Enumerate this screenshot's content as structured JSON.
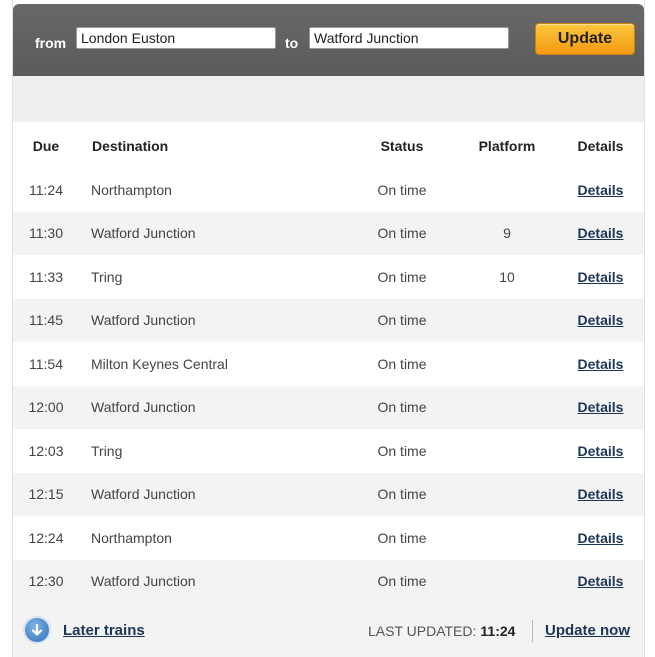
{
  "search": {
    "from_label": "from",
    "from_value": "London Euston",
    "to_label": "to",
    "to_value": "Watford Junction",
    "update_label": "Update"
  },
  "table": {
    "headers": {
      "due": "Due",
      "destination": "Destination",
      "status": "Status",
      "platform": "Platform",
      "details": "Details"
    },
    "rows": [
      {
        "due": "11:24",
        "destination": "Northampton",
        "status": "On time",
        "platform": "",
        "details": "Details"
      },
      {
        "due": "11:30",
        "destination": "Watford Junction",
        "status": "On time",
        "platform": "9",
        "details": "Details"
      },
      {
        "due": "11:33",
        "destination": "Tring",
        "status": "On time",
        "platform": "10",
        "details": "Details"
      },
      {
        "due": "11:45",
        "destination": "Watford Junction",
        "status": "On time",
        "platform": "",
        "details": "Details"
      },
      {
        "due": "11:54",
        "destination": "Milton Keynes Central",
        "status": "On time",
        "platform": "",
        "details": "Details"
      },
      {
        "due": "12:00",
        "destination": "Watford Junction",
        "status": "On time",
        "platform": "",
        "details": "Details"
      },
      {
        "due": "12:03",
        "destination": "Tring",
        "status": "On time",
        "platform": "",
        "details": "Details"
      },
      {
        "due": "12:15",
        "destination": "Watford Junction",
        "status": "On time",
        "platform": "",
        "details": "Details"
      },
      {
        "due": "12:24",
        "destination": "Northampton",
        "status": "On time",
        "platform": "",
        "details": "Details"
      },
      {
        "due": "12:30",
        "destination": "Watford Junction",
        "status": "On time",
        "platform": "",
        "details": "Details"
      }
    ]
  },
  "footer": {
    "later_icon": "arrow-down-circle-icon",
    "later_label": "Later trains",
    "last_updated_label": "LAST UPDATED:",
    "last_updated_time": "11:24",
    "update_now_label": "Update now"
  },
  "colors": {
    "header_bg": "#616161",
    "button_accent": "#f6a91f",
    "link": "#1d3557"
  }
}
